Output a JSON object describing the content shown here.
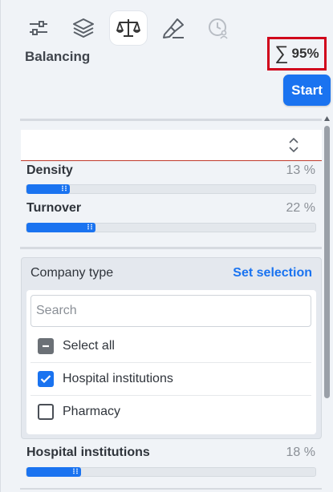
{
  "toolbar": {
    "tools": [
      {
        "name": "filters",
        "icon": "sliders-icon",
        "active": false
      },
      {
        "name": "layers",
        "icon": "layers-icon",
        "active": false
      },
      {
        "name": "balancing",
        "icon": "balance-scale-icon",
        "active": true
      },
      {
        "name": "brush",
        "icon": "brush-icon",
        "active": false
      },
      {
        "name": "history",
        "icon": "clock-user-icon",
        "active": false
      }
    ]
  },
  "header": {
    "title": "Balancing",
    "sum_symbol": "∑",
    "sum_value": "95%",
    "start_label": "Start"
  },
  "metrics": {
    "density": {
      "label": "Density",
      "value": "13 %",
      "fill_percent": 15
    },
    "turnover": {
      "label": "Turnover",
      "value": "22 %",
      "fill_percent": 24
    }
  },
  "filter": {
    "title": "Company type",
    "link": "Set selection",
    "search_placeholder": "Search",
    "options": [
      {
        "label": "Select all",
        "state": "partial"
      },
      {
        "label": "Hospital institutions",
        "state": "checked"
      },
      {
        "label": "Pharmacy",
        "state": "unchecked"
      }
    ]
  },
  "bottom_metric": {
    "label": "Hospital institutions",
    "value": "18 %",
    "fill_percent": 19
  },
  "colors": {
    "accent": "#1a73f0",
    "highlight": "#d0021b"
  }
}
